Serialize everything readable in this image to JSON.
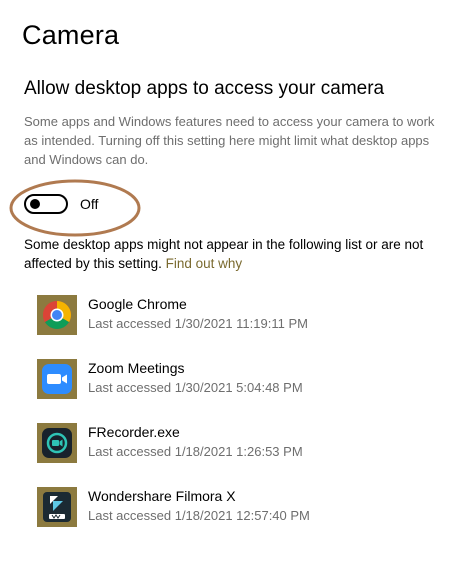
{
  "page": {
    "title": "Camera"
  },
  "desktop_apps": {
    "heading": "Allow desktop apps to access your camera",
    "description": "Some apps and Windows features need to access your camera to work as intended. Turning off this setting here might limit what desktop apps and Windows can do.",
    "toggle": {
      "state_label": "Off",
      "is_on": false
    },
    "note": "Some desktop apps might not appear in the following list or are not affected by this setting.",
    "find_out_link": "Find out why",
    "apps": [
      {
        "name": "Google Chrome",
        "last_accessed": "Last accessed 1/30/2021 11:19:11 PM",
        "icon": "chrome-icon"
      },
      {
        "name": "Zoom Meetings",
        "last_accessed": "Last accessed 1/30/2021 5:04:48 PM",
        "icon": "zoom-icon"
      },
      {
        "name": "FRecorder.exe",
        "last_accessed": "Last accessed 1/18/2021 1:26:53 PM",
        "icon": "frecorder-icon"
      },
      {
        "name": "Wondershare Filmora X",
        "last_accessed": "Last accessed 1/18/2021 12:57:40 PM",
        "icon": "filmora-icon"
      }
    ]
  },
  "colors": {
    "app_tile_background": "#8c7a3f",
    "link": "#7a6a2f",
    "secondary_text": "#6e6e6e",
    "annotation_oval": "#b07a50"
  }
}
